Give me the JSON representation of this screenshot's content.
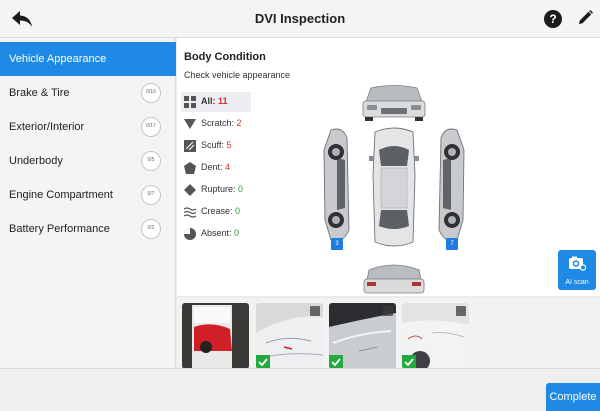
{
  "header": {
    "title": "DVI Inspection",
    "help_icon": "help-icon",
    "back_icon": "back-arrow-icon",
    "edit_icon": "pencil-icon"
  },
  "sidebar": {
    "items": [
      {
        "label": "Vehicle Appearance",
        "active": true,
        "progress": ""
      },
      {
        "label": "Brake & Tire",
        "active": false,
        "progress": "0/16"
      },
      {
        "label": "Exterior/Interior",
        "active": false,
        "progress": "0/17"
      },
      {
        "label": "Underbody",
        "active": false,
        "progress": "0/5"
      },
      {
        "label": "Engine Compartment",
        "active": false,
        "progress": "0/7"
      },
      {
        "label": "Battery Performance",
        "active": false,
        "progress": "0/2"
      }
    ]
  },
  "main": {
    "title": "Body Condition",
    "subtitle": "Check vehicle appearance",
    "damage_types": [
      {
        "label": "All:",
        "count": "11",
        "color": "#d0312d",
        "icon": "grid-icon"
      },
      {
        "label": "Scratch:",
        "count": "2",
        "color": "#d0312d",
        "icon": "scratch-triangle-icon"
      },
      {
        "label": "Scuff:",
        "count": "5",
        "color": "#d0312d",
        "icon": "scuff-square-icon"
      },
      {
        "label": "Dent:",
        "count": "4",
        "color": "#d0312d",
        "icon": "dent-pentagon-icon"
      },
      {
        "label": "Rupture:",
        "count": "0",
        "color": "#2a9d3a",
        "icon": "rupture-diamond-icon"
      },
      {
        "label": "Crease:",
        "count": "0",
        "color": "#2a9d3a",
        "icon": "crease-waves-icon"
      },
      {
        "label": "Absent:",
        "count": "0",
        "color": "#2a9d3a",
        "icon": "absent-pie-icon"
      }
    ],
    "car_badges": {
      "left": "3",
      "right": "7",
      "rear": "1"
    },
    "ai_scan_label": "AI scan"
  },
  "photos": [
    {
      "name": "photo-1",
      "checked": false
    },
    {
      "name": "photo-2",
      "checked": true
    },
    {
      "name": "photo-3",
      "checked": true
    },
    {
      "name": "photo-4",
      "checked": true
    }
  ],
  "footer": {
    "complete_label": "Complete"
  },
  "colors": {
    "accent": "#1e8ae6",
    "danger": "#d0312d",
    "ok": "#2a9d3a"
  }
}
